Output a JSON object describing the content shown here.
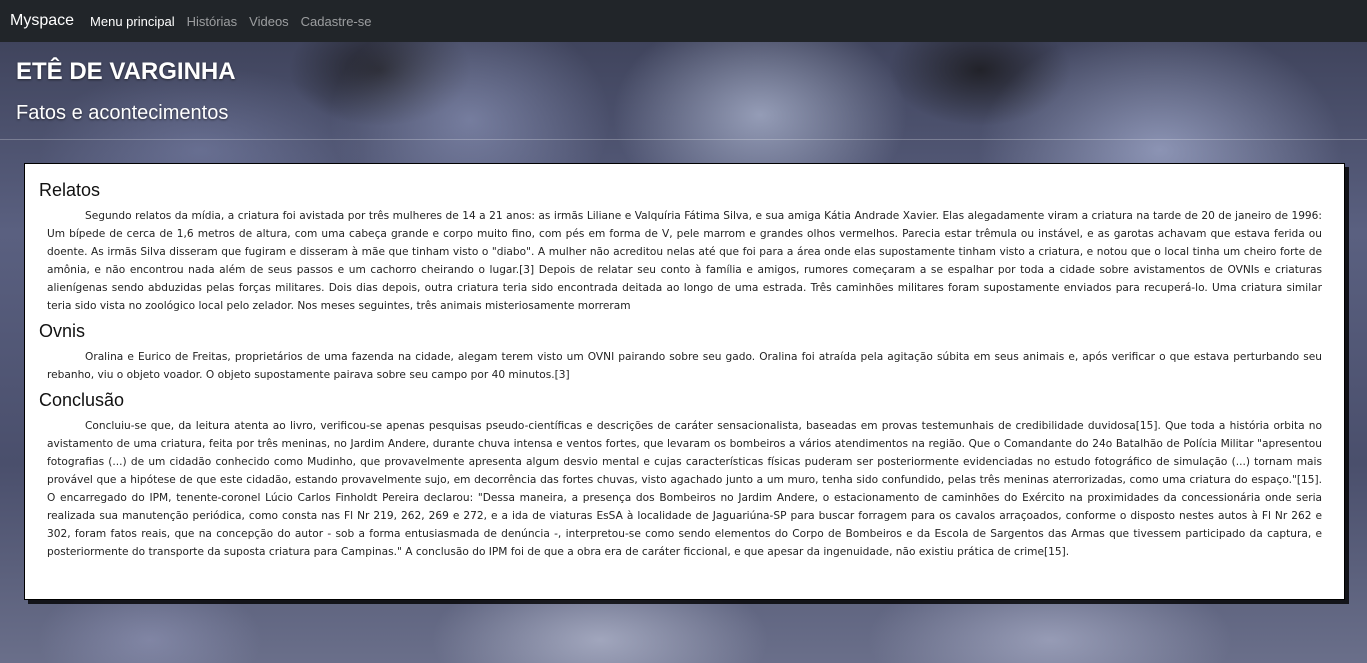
{
  "navbar": {
    "brand": "Myspace",
    "items": [
      {
        "label": "Menu principal",
        "active": true
      },
      {
        "label": "Histórias",
        "active": false
      },
      {
        "label": "Videos",
        "active": false
      },
      {
        "label": "Cadastre-se",
        "active": false
      }
    ]
  },
  "header": {
    "title": "ETÊ DE VARGINHA",
    "subtitle": "Fatos e acontecimentos"
  },
  "sections": [
    {
      "title": "Relatos",
      "text": "Segundo relatos da mídia, a criatura foi avistada por três mulheres de 14 a 21 anos: as irmãs Liliane e Valquíria Fátima Silva, e sua amiga Kátia Andrade Xavier. Elas alegadamente viram a criatura na tarde de 20 de janeiro de 1996: Um bípede de cerca de 1,6 metros de altura, com uma cabeça grande e corpo muito fino, com pés em forma de V, pele marrom e grandes olhos vermelhos. Parecia estar trêmula ou instável, e as garotas achavam que estava ferida ou doente. As irmãs Silva disseram que fugiram e disseram à mãe que tinham visto o \"diabo\". A mulher não acreditou nelas até que foi para a área onde elas supostamente tinham visto a criatura, e notou que o local tinha um cheiro forte de amônia, e não encontrou nada além de seus passos e um cachorro cheirando o lugar.[3] Depois de relatar seu conto à família e amigos, rumores começaram a se espalhar por toda a cidade sobre avistamentos de OVNIs e criaturas alienígenas sendo abduzidas pelas forças militares. Dois dias depois, outra criatura teria sido encontrada deitada ao longo de uma estrada. Três caminhões militares foram supostamente enviados para recuperá-lo. Uma criatura similar teria sido vista no zoológico local pelo zelador. Nos meses seguintes, três animais misteriosamente morreram"
    },
    {
      "title": "Ovnis",
      "text": "Oralina e Eurico de Freitas, proprietários de uma fazenda na cidade, alegam terem visto um OVNI pairando sobre seu gado. Oralina foi atraída pela agitação súbita em seus animais e, após verificar o que estava perturbando seu rebanho, viu o objeto voador. O objeto supostamente pairava sobre seu campo por 40 minutos.[3]"
    },
    {
      "title": "Conclusão",
      "text": "Concluiu-se que, da leitura atenta ao livro, verificou-se apenas pesquisas pseudo-científicas e descrições de caráter sensacionalista, baseadas em provas testemunhais de credibilidade duvidosa[15]. Que toda a história orbita no avistamento de uma criatura, feita por três meninas, no Jardim Andere, durante chuva intensa e ventos fortes, que levaram os bombeiros a vários atendimentos na região. Que o Comandante do 24o Batalhão de Polícia Militar \"apresentou fotografias (...) de um cidadão conhecido como Mudinho, que provavelmente apresenta algum desvio mental e cujas características físicas puderam ser posteriormente evidenciadas no estudo fotográfico de simulação (...) tornam mais provável que a hipótese de que este cidadão, estando provavelmente sujo, em decorrência das fortes chuvas, visto agachado junto a um muro, tenha sido confundido, pelas três meninas aterrorizadas, como uma criatura do espaço.\"[15]. O encarregado do IPM, tenente-coronel Lúcio Carlos Finholdt Pereira declarou: \"Dessa maneira, a presença dos Bombeiros no Jardim Andere, o estacionamento de caminhões do Exército na proximidades da concessionária onde seria realizada sua manutenção periódica, como consta nas Fl Nr 219, 262, 269 e 272, e a ida de viaturas EsSA à localidade de Jaguariúna-SP para buscar forragem para os cavalos arraçoados, conforme o disposto nestes autos à Fl Nr 262 e 302, foram fatos reais, que na concepção do autor - sob a forma entusiasmada de denúncia -, interpretou-se como sendo elementos do Corpo de Bombeiros e da Escola de Sargentos das Armas que tivessem participado da captura, e posteriormente do transporte da suposta criatura para Campinas.\" A conclusão do IPM foi de que a obra era de caráter ficcional, e que apesar da ingenuidade, não existiu prática de crime[15]."
    }
  ]
}
